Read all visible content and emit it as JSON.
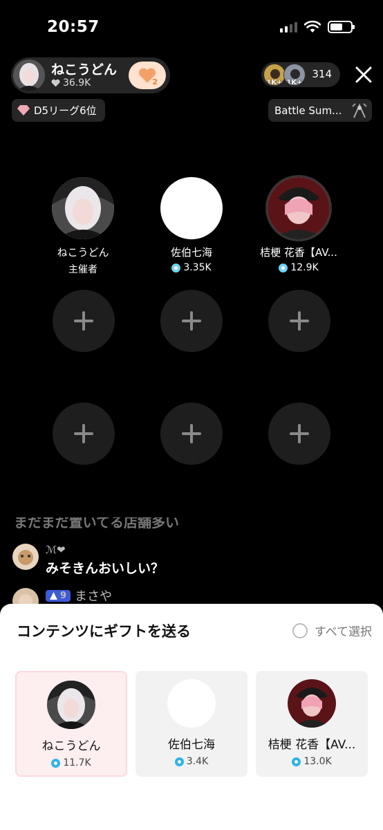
{
  "status": {
    "time": "20:57",
    "battery_level": 0.6
  },
  "host": {
    "name": "ねこうどん",
    "likes": "36.9K",
    "heart_count": "2"
  },
  "league": {
    "label": "D5リーグ6位"
  },
  "viewers": {
    "badge_1": "1K+",
    "badge_2": "1K+",
    "count": "314"
  },
  "battle": {
    "label": "Battle Sum..."
  },
  "guests": [
    {
      "name": "ねこうどん",
      "sub": "主催者"
    },
    {
      "name": "佐伯七海",
      "sub": "3.35K"
    },
    {
      "name": "桔梗 花香【AV...",
      "sub": "12.9K"
    }
  ],
  "chat": {
    "faded_text": "まだまだ置いてる店舗多い",
    "messages": [
      {
        "user": "ℳ❤",
        "text": "みそきんおいしい？"
      },
      {
        "level": "9",
        "user": "まさや"
      }
    ]
  },
  "gift_sheet": {
    "title": "コンテンツにギフトを送る",
    "select_all": "すべて選択",
    "cards": [
      {
        "name": "ねこうどん",
        "value": "11.7K"
      },
      {
        "name": "佐伯七海",
        "value": "3.4K"
      },
      {
        "name": "桔梗 花香【AV...",
        "value": "13.0K"
      }
    ]
  },
  "colors": {
    "accent_coin": "#6fd3f5",
    "heart_bg": "#ffe2cf",
    "selected_card": "#fdeef0",
    "level_badge": "#3d5bd6"
  }
}
